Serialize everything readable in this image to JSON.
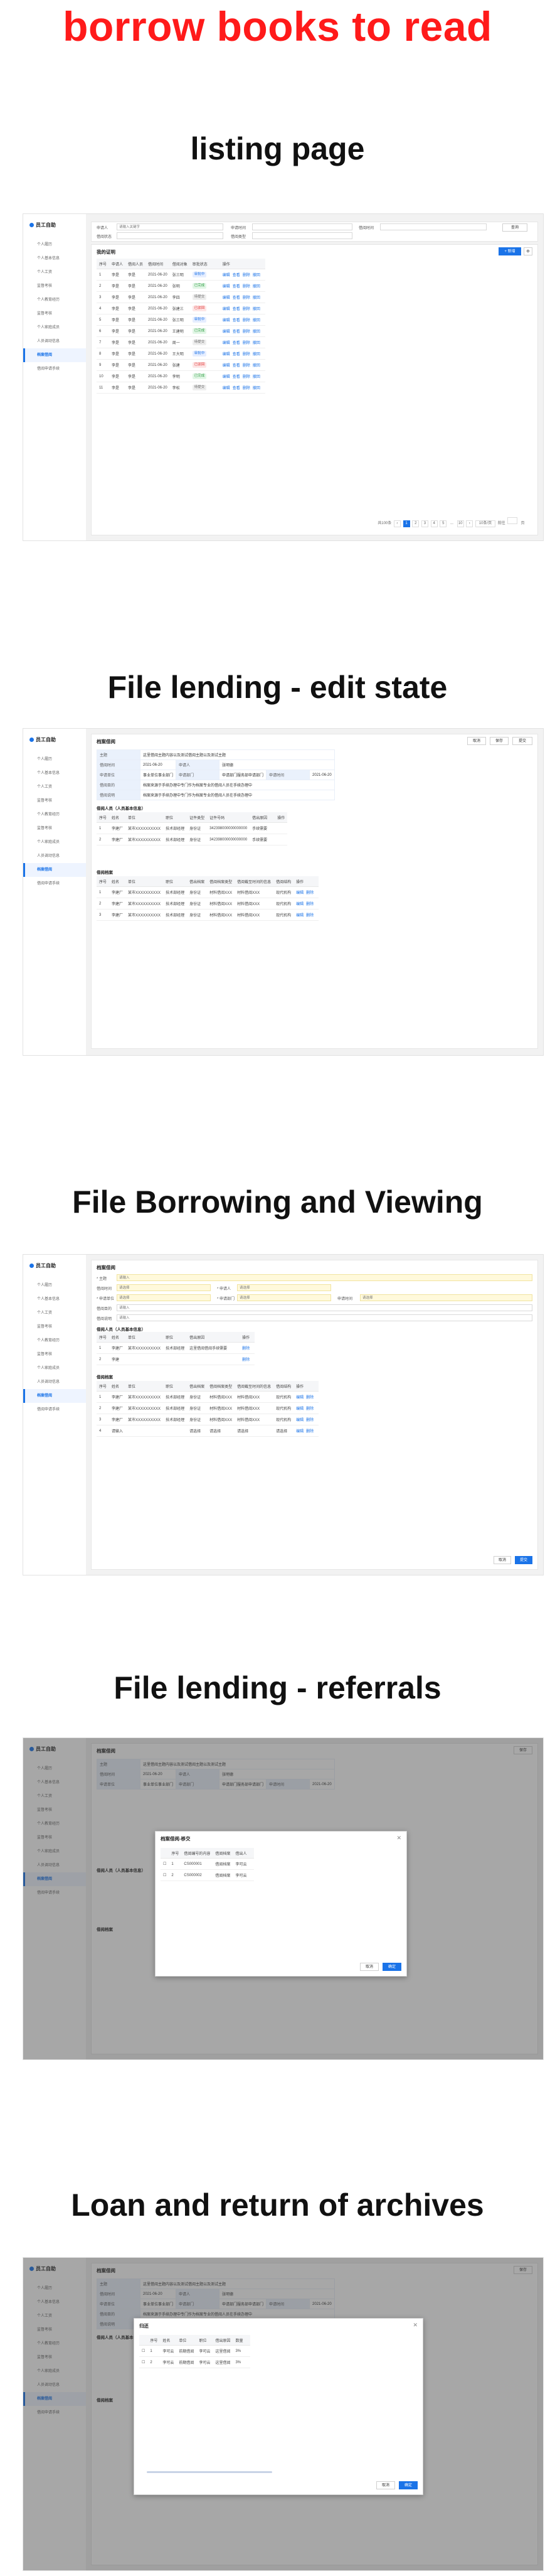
{
  "page": {
    "main_title": "borrow books to read",
    "section_titles": [
      "listing page",
      "File lending - edit state",
      "File Borrowing and Viewing",
      "File lending - referrals",
      "Loan and return of archives"
    ]
  },
  "sidebar": {
    "app_name": "员工自助",
    "items": [
      "个人履历",
      "个人基本信息",
      "个人工资",
      "监督考核",
      "个人教育经历",
      "监督考核",
      "个人家庭成员",
      "人员调动信息",
      "档案借阅",
      "借阅申请手续"
    ]
  },
  "listing": {
    "filters": {
      "label1": "申请人",
      "value1": "请输入关键字",
      "label2": "申请时间",
      "label3": "借阅时间",
      "label4": "借阅状态",
      "label5": "借阅类型",
      "search_btn": "查询"
    },
    "table_title": "我的证明",
    "add_btn": "+ 新增",
    "columns": [
      "序号",
      "申请人",
      "借阅人员",
      "借阅时间",
      "借阅对象",
      "审批状态",
      "",
      "",
      "操作"
    ],
    "rows": [
      {
        "no": "1",
        "a": "李是",
        "b": "李是",
        "date": "2021-06-20",
        "obj": "张三明",
        "status": "审批中",
        "ops": [
          "编辑",
          "查看",
          "删除",
          "撤回"
        ]
      },
      {
        "no": "2",
        "a": "李是",
        "b": "李是",
        "date": "2021-06-20",
        "obj": "张明",
        "status": "已完成",
        "ops": [
          "编辑",
          "查看",
          "删除",
          "撤回"
        ]
      },
      {
        "no": "3",
        "a": "李是",
        "b": "李是",
        "date": "2021-06-20",
        "obj": "李四",
        "status": "待提交",
        "ops": [
          "编辑",
          "查看",
          "删除",
          "撤回"
        ]
      },
      {
        "no": "4",
        "a": "李是",
        "b": "李是",
        "date": "2021-06-20",
        "obj": "张建三",
        "status": "已驳回",
        "ops": [
          "编辑",
          "查看",
          "删除",
          "撤回"
        ]
      },
      {
        "no": "5",
        "a": "李是",
        "b": "李是",
        "date": "2021-06-20",
        "obj": "张三明",
        "status": "审批中",
        "ops": [
          "编辑",
          "查看",
          "删除",
          "撤回"
        ]
      },
      {
        "no": "6",
        "a": "李是",
        "b": "李是",
        "date": "2021-06-20",
        "obj": "王建明",
        "status": "已完成",
        "ops": [
          "编辑",
          "查看",
          "删除",
          "撤回"
        ]
      },
      {
        "no": "7",
        "a": "李是",
        "b": "李是",
        "date": "2021-06-20",
        "obj": "周一",
        "status": "待提交",
        "ops": [
          "编辑",
          "查看",
          "删除",
          "撤回"
        ]
      },
      {
        "no": "8",
        "a": "李是",
        "b": "李是",
        "date": "2021-06-20",
        "obj": "王大明",
        "status": "审批中",
        "ops": [
          "编辑",
          "查看",
          "删除",
          "撤回"
        ]
      },
      {
        "no": "9",
        "a": "李是",
        "b": "李是",
        "date": "2021-06-20",
        "obj": "张建",
        "status": "已驳回",
        "ops": [
          "编辑",
          "查看",
          "删除",
          "撤回"
        ]
      },
      {
        "no": "10",
        "a": "李是",
        "b": "李是",
        "date": "2021-06-20",
        "obj": "李明",
        "status": "已完成",
        "ops": [
          "编辑",
          "查看",
          "删除",
          "撤回"
        ]
      },
      {
        "no": "11",
        "a": "李是",
        "b": "李是",
        "date": "2021-06-20",
        "obj": "李松",
        "status": "待提交",
        "ops": [
          "编辑",
          "查看",
          "删除",
          "撤回"
        ]
      }
    ],
    "pager": {
      "total": "共100条",
      "pages": [
        "1",
        "2",
        "3",
        "4",
        "5",
        "...",
        "10"
      ],
      "size": "10条/页",
      "goto": "前往",
      "page_word": "页"
    }
  },
  "edit_state": {
    "header": "档案借阅",
    "actions": [
      "取消",
      "保存",
      "提交"
    ],
    "info": {
      "k1": "主题",
      "v1": "这里借阅主题内容以及测试借阅主题以及测试主题",
      "k2": "借阅时间",
      "v2": "2021-06-20",
      "k2b": "申请人",
      "v2b": "张明德",
      "k3": "申请单位",
      "v3": "事业单位事业部门",
      "k3b": "申请部门",
      "v3b": "申请部门服务部申请部门",
      "k3c": "申请时间",
      "v3c": "2021-06-20",
      "k4": "借阅目的",
      "v4": "档案来源于手续办理中专门作为档案专业的借阅人员在手续办理中",
      "k5": "借阅说明",
      "v5": "档案来源于手续办理中专门作为档案专业的借阅人员在手续办理中"
    },
    "s1_title": "借阅人员（人员基本信息）",
    "s1_columns": [
      "序号",
      "姓名",
      "单位",
      "职位",
      "证件类型",
      "证件号码",
      "借出原因",
      "",
      "操作"
    ],
    "s1_rows": [
      {
        "no": "1",
        "name": "李建厂",
        "unit": "某市XXXXXXXXXX",
        "pos": "技术部经理",
        "type": "身份证",
        "id": "342398000000000000",
        "reason": "手续需要"
      },
      {
        "no": "2",
        "name": "李建厂",
        "unit": "某市XXXXXXXXXX",
        "pos": "技术部经理",
        "type": "身份证",
        "id": "342398000000000000",
        "reason": "手续需要"
      }
    ],
    "s2_title": "借阅档案",
    "s2_columns": [
      "序号",
      "姓名",
      "单位",
      "职位",
      "借出档案",
      "借阅档案类型",
      "借阅截至时间的信息",
      "借阅结构",
      "操作"
    ],
    "s2_rows": [
      {
        "no": "1",
        "name": "李建厂",
        "unit": "某市XXXXXXXXXX",
        "pos": "技术部经理",
        "doc": "身份证",
        "type": "材料借阅XXX",
        "deadline": "材料借阅XXX",
        "org": "现代机构",
        "ops": [
          "编辑",
          "删除"
        ]
      },
      {
        "no": "2",
        "name": "李建厂",
        "unit": "某市XXXXXXXXXX",
        "pos": "技术部经理",
        "doc": "身份证",
        "type": "材料借阅XXX",
        "deadline": "材料借阅XXX",
        "org": "现代机构",
        "ops": [
          "编辑",
          "删除"
        ]
      },
      {
        "no": "3",
        "name": "李建厂",
        "unit": "某市XXXXXXXXXX",
        "pos": "技术部经理",
        "doc": "身份证",
        "type": "材料借阅XXX",
        "deadline": "材料借阅XXX",
        "org": "现代机构",
        "ops": [
          "编辑",
          "删除"
        ]
      }
    ]
  },
  "viewing": {
    "header": "档案借阅",
    "labels": {
      "theme": "* 主题",
      "date": "借阅时间",
      "applicant": "* 申请人",
      "apply_date": "申请时间",
      "unit": "* 申请单位",
      "dept": "* 申请部门",
      "purpose": "借阅目的",
      "remark": "借阅说明"
    },
    "placeholders": {
      "text": "请输入",
      "select": "请选择"
    },
    "s1_title": "借阅人员（人员基本信息）",
    "s1_columns": [
      "序号",
      "姓名",
      "单位",
      "职位",
      "借出原因",
      "",
      "",
      "操作"
    ],
    "s1_rows": [
      {
        "no": "1",
        "name": "李建厂",
        "unit": "某市XXXXXXXXXX",
        "pos": "技术部经理",
        "reason": "这里借阅借阅手续需要",
        "ops": [
          "删除"
        ]
      },
      {
        "no": "2",
        "name": "李建",
        "unit": "",
        "pos": "",
        "reason": "",
        "ops": [
          "删除"
        ]
      }
    ],
    "s2_title": "借阅档案",
    "s2_rows": [
      {
        "no": "1",
        "name": "李建厂",
        "unit": "某市XXXXXXXXXX",
        "pos": "技术部经理",
        "doc": "身份证",
        "type": "材料借阅XXX",
        "deadline": "材料借阅XXX",
        "org": "现代机构"
      },
      {
        "no": "2",
        "name": "李建厂",
        "unit": "某市XXXXXXXXXX",
        "pos": "技术部经理",
        "doc": "身份证",
        "type": "材料借阅XXX",
        "deadline": "材料借阅XXX",
        "org": "现代机构"
      },
      {
        "no": "3",
        "name": "李建厂",
        "unit": "某市XXXXXXXXXX",
        "pos": "技术部经理",
        "doc": "身份证",
        "type": "材料借阅XXX",
        "deadline": "材料借阅XXX",
        "org": "现代机构"
      },
      {
        "no": "4",
        "name": "请输入",
        "unit": "",
        "pos": "",
        "doc": "请选择",
        "type": "请选择",
        "deadline": "请选择",
        "org": "请选择"
      }
    ],
    "row_ops": [
      "编辑",
      "删除"
    ],
    "cancel_btn": "取消",
    "submit_btn": "提交"
  },
  "referrals": {
    "modal_title": "档案借阅-移交",
    "columns": [
      "",
      "序号",
      "借阅编号的内容",
      "借阅档案",
      "借出人",
      ""
    ],
    "rows": [
      {
        "no": "1",
        "code": "CS000001",
        "doc": "借阅档案",
        "person": "李可云"
      },
      {
        "no": "2",
        "code": "CS000002",
        "doc": "借阅档案",
        "person": "李可云"
      }
    ],
    "cancel_btn": "取消",
    "ok_btn": "确定"
  },
  "loan_return": {
    "modal_title": "归还",
    "columns": [
      "",
      "序号",
      "姓名",
      "单位",
      "职位",
      "借出原因",
      "数量",
      ""
    ],
    "rows": [
      {
        "no": "1",
        "name": "李可云",
        "unit": "前期借阅",
        "pos": "李可云",
        "reason": "这里借阅",
        "qty": "3%"
      },
      {
        "no": "2",
        "name": "李可云",
        "unit": "前期借阅",
        "pos": "李可云",
        "reason": "这里借阅",
        "qty": "3%"
      }
    ],
    "cancel_btn": "取消",
    "ok_btn": "确定"
  }
}
